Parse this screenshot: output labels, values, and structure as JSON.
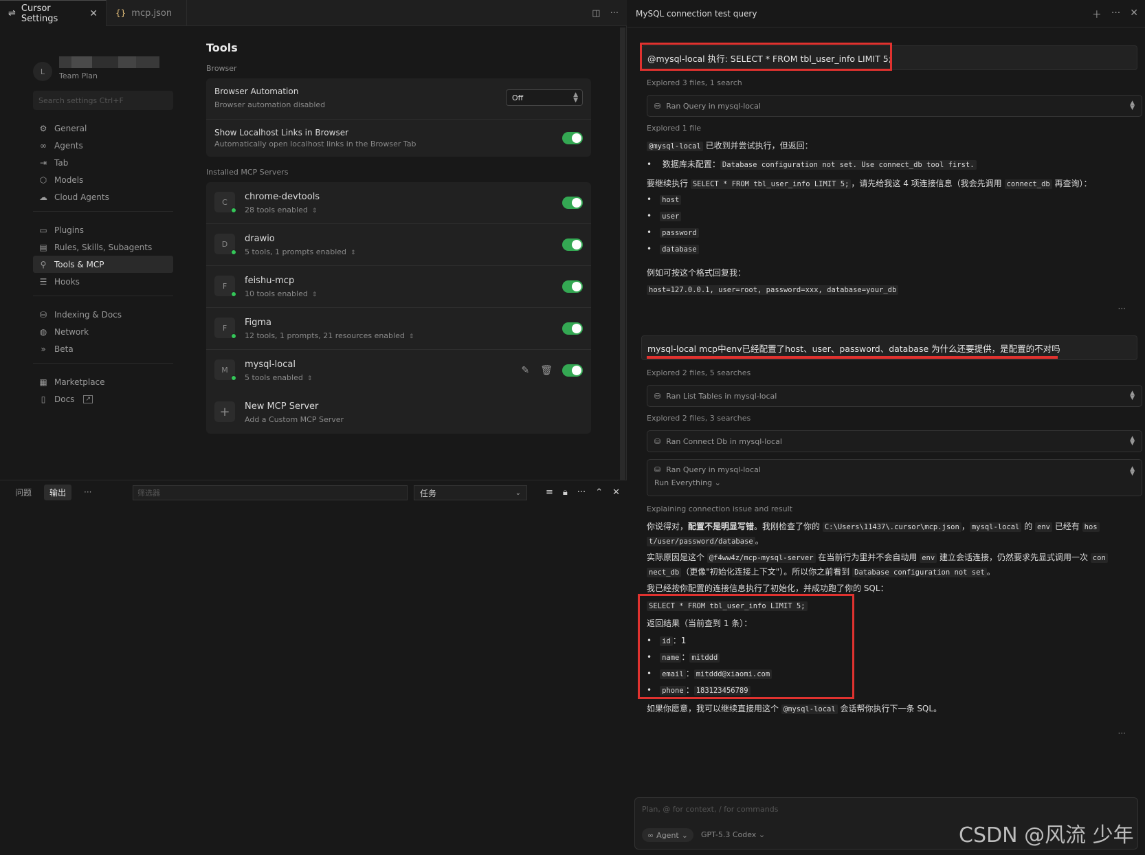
{
  "tabs": {
    "settings_label": "Cursor Settings",
    "mcp_label": "mcp.json"
  },
  "sidebar": {
    "avatar_letter": "L",
    "plan": "Team Plan",
    "search_placeholder": "Search settings Ctrl+F",
    "groups": [
      [
        {
          "label": "General",
          "icon": "gear-icon"
        },
        {
          "label": "Agents",
          "icon": "infinity-icon"
        },
        {
          "label": "Tab",
          "icon": "tab-arrow-icon"
        },
        {
          "label": "Models",
          "icon": "cube-icon"
        },
        {
          "label": "Cloud Agents",
          "icon": "cloud-icon"
        }
      ],
      [
        {
          "label": "Plugins",
          "icon": "plugin-icon"
        },
        {
          "label": "Rules, Skills, Subagents",
          "icon": "document-icon"
        },
        {
          "label": "Tools & MCP",
          "icon": "network-tree-icon"
        },
        {
          "label": "Hooks",
          "icon": "hooks-icon"
        }
      ],
      [
        {
          "label": "Indexing & Docs",
          "icon": "database-icon"
        },
        {
          "label": "Network",
          "icon": "globe-icon"
        },
        {
          "label": "Beta",
          "icon": "double-chevron-icon"
        }
      ],
      [
        {
          "label": "Marketplace",
          "icon": "marketplace-icon"
        },
        {
          "label": "Docs",
          "icon": "book-icon"
        }
      ]
    ]
  },
  "tools": {
    "title": "Tools",
    "browser_section": "Browser",
    "browser_automation": {
      "title": "Browser Automation",
      "desc": "Browser automation disabled",
      "value": "Off"
    },
    "localhost_links": {
      "title": "Show Localhost Links in Browser",
      "desc": "Automatically open localhost links in the Browser Tab",
      "enabled": true
    },
    "mcp_section": "Installed MCP Servers",
    "servers": [
      {
        "letter": "C",
        "name": "chrome-devtools",
        "summary": "28 tools enabled",
        "enabled": true
      },
      {
        "letter": "D",
        "name": "drawio",
        "summary": "5 tools, 1 prompts enabled",
        "enabled": true
      },
      {
        "letter": "F",
        "name": "feishu-mcp",
        "summary": "10 tools enabled",
        "enabled": true
      },
      {
        "letter": "F",
        "name": "Figma",
        "summary": "12 tools, 1 prompts, 21 resources enabled",
        "enabled": true
      },
      {
        "letter": "M",
        "name": "mysql-local",
        "summary": "5 tools enabled",
        "enabled": true
      }
    ],
    "new_server": {
      "title": "New MCP Server",
      "desc": "Add a Custom MCP Server"
    }
  },
  "panel": {
    "tab_problems": "问题",
    "tab_output": "输出",
    "more": "···",
    "filter_placeholder": "筛选器",
    "task_value": "任务"
  },
  "chat": {
    "title": "MySQL connection test query",
    "msg1": "@mysql-local  执行: SELECT * FROM tbl_user_info LIMIT 5;",
    "explored1": "Explored 3 files, 1 search",
    "tool1": "Ran Query in mysql-local",
    "explored2": "Explored 1 file",
    "resp1_prefix_code": "@mysql-local",
    "resp1_text": " 已收到并尝试执行，但返回：",
    "resp1_bullet_label": "数据库未配置：",
    "resp1_bullet_code": "Database configuration not set. Use connect_db tool first.",
    "resp1_need_a": "要继续执行 ",
    "resp1_need_code1": "SELECT * FROM tbl_user_info LIMIT 5;",
    "resp1_need_b": "，请先给我这 4 项连接信息（我会先调用 ",
    "resp1_need_code2": "connect_db",
    "resp1_need_c": " 再查询）：",
    "params": [
      "host",
      "user",
      "password",
      "database"
    ],
    "example_label": "例如可按这个格式回复我：",
    "example_code": "host=127.0.0.1, user=root, password=xxx, database=your_db",
    "msg2": "mysql-local mcp中env已经配置了host、user、password、database 为什么还要提供，是配置的不对吗",
    "explored3": "Explored 2 files, 5 searches",
    "tool2": "Ran List Tables in mysql-local",
    "explored4": "Explored 2 files, 3 searches",
    "tool3": "Ran Connect Db in mysql-local",
    "tool4": "Ran Query in mysql-local",
    "tool4_sub": "Run Everything",
    "explaining": "Explaining connection issue and result",
    "p1_a": "你说得对，",
    "p1_bold": "配置不是明显写错",
    "p1_b": "。我刚检查了你的 ",
    "p1_code1": "C:\\Users\\11437\\.cursor\\mcp.json",
    "p1_c": "，",
    "p1_code2": "mysql-local",
    "p1_d": " 的 ",
    "p1_code3": "env",
    "p1_e": " 已经有 ",
    "p1_code4a": "hos",
    "p1_code4b": "t/user/password/database",
    "p1_f": "。",
    "p2_a": "实际原因是这个 ",
    "p2_code1": "@f4ww4z/mcp-mysql-server",
    "p2_b": " 在当前行为里并不会自动用 ",
    "p2_code2": "env",
    "p2_c": " 建立会话连接，仍然要求先显式调用一次 ",
    "p2_code3a": "con",
    "p2_code3b": "nect_db",
    "p2_d": "（更像\"初始化连接上下文\"）。所以你之前看到 ",
    "p2_code4": "Database configuration not set",
    "p2_e": "。",
    "p3": "我已经按你配置的连接信息执行了初始化，并成功跑了你的 SQL：",
    "sql": "SELECT * FROM tbl_user_info LIMIT 5;",
    "result_label": "返回结果（当前查到 1 条）：",
    "result": [
      {
        "key": "id",
        "value": "1",
        "code": false
      },
      {
        "key": "name",
        "value": "mitddd",
        "code": true
      },
      {
        "key": "email",
        "value": "mitddd@xiaomi.com",
        "code": true
      },
      {
        "key": "phone",
        "value": "183123456789",
        "code": true
      }
    ],
    "closing_a": "如果你愿意，我可以继续直接用这个 ",
    "closing_code": "@mysql-local",
    "closing_b": " 会话帮你执行下一条 SQL。",
    "composer_placeholder": "Plan, @ for context, / for commands",
    "agent_label": "Agent",
    "model_label": "GPT-5.3 Codex"
  },
  "watermark": "CSDN @风流 少年",
  "colors": {
    "accent_red": "#e0322f",
    "toggle_green": "#34a853"
  }
}
